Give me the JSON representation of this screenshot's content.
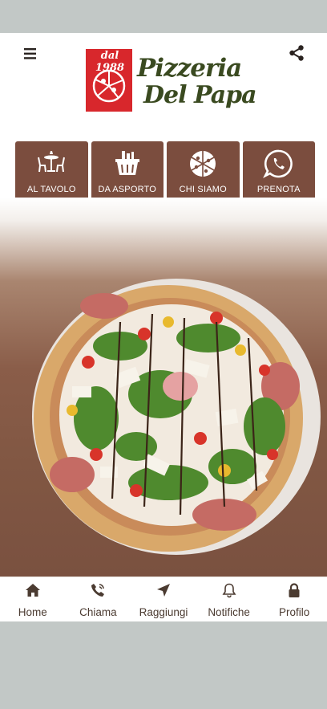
{
  "header": {
    "logo_year": "dal 1988",
    "logo_line1": "Pizzeria",
    "logo_line2": "Del Papa"
  },
  "quick_actions": [
    {
      "label": "AL TAVOLO",
      "icon": "table-icon"
    },
    {
      "label": "DA ASPORTO",
      "icon": "basket-icon"
    },
    {
      "label": "CHI SIAMO",
      "icon": "pizza-icon"
    },
    {
      "label": "PRENOTA",
      "icon": "whatsapp-icon"
    }
  ],
  "tabs": [
    {
      "label": "Home",
      "icon": "home-icon"
    },
    {
      "label": "Chiama",
      "icon": "phone-icon"
    },
    {
      "label": "Raggiungi",
      "icon": "navigation-icon"
    },
    {
      "label": "Notifiche",
      "icon": "bell-icon"
    },
    {
      "label": "Profilo",
      "icon": "lock-icon"
    }
  ],
  "colors": {
    "brown": "#7b4d3e",
    "tab_text": "#4b3b31",
    "logo_red": "#d8272c",
    "logo_green": "#3a4a20"
  }
}
